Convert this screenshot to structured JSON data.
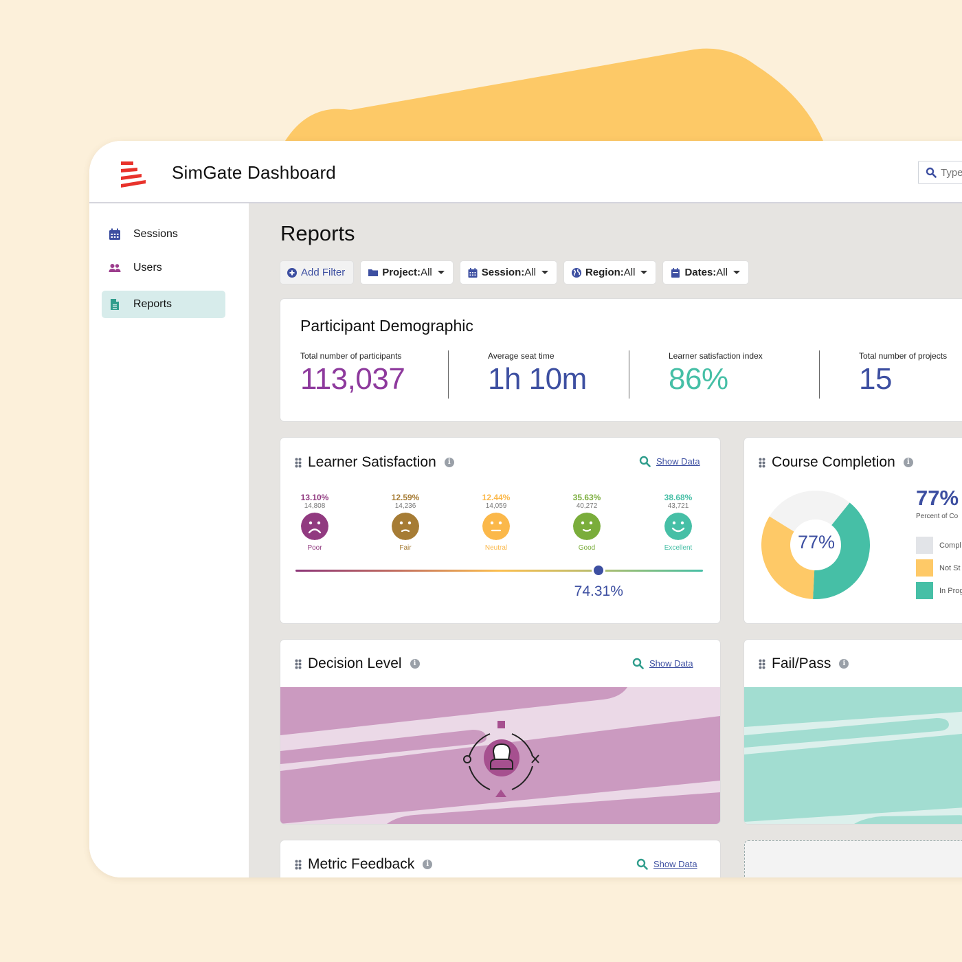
{
  "app": {
    "title": "SimGate Dashboard",
    "search_placeholder": "Type"
  },
  "sidebar": {
    "items": [
      {
        "label": "Sessions",
        "icon": "calendar-icon",
        "active": false
      },
      {
        "label": "Users",
        "icon": "users-icon",
        "active": false
      },
      {
        "label": "Reports",
        "icon": "document-icon",
        "active": true
      }
    ]
  },
  "page": {
    "title": "Reports",
    "filters": [
      {
        "label": "Add Filter",
        "key": "",
        "value": "",
        "icon": "plus-circle-icon"
      },
      {
        "key": "Project:",
        "value": " All",
        "icon": "folder-icon"
      },
      {
        "key": "Session:",
        "value": " All",
        "icon": "calendar-icon"
      },
      {
        "key": "Region:",
        "value": " All",
        "icon": "globe-icon"
      },
      {
        "key": "Dates:",
        "value": " All",
        "icon": "calendar-day-icon"
      }
    ]
  },
  "demographic": {
    "title": "Participant Demographic",
    "stats": [
      {
        "label": "Total number of participants",
        "value": "113,037",
        "color": "#8e3a9d"
      },
      {
        "label": "Average seat time",
        "value": "1h 10m",
        "color": "#3d4fa1"
      },
      {
        "label": "Learner satisfaction index",
        "value": "86%",
        "color": "#46bfa6"
      },
      {
        "label": "Total number of projects",
        "value": "15",
        "color": "#3d4fa1"
      }
    ]
  },
  "satisfaction": {
    "title": "Learner Satisfaction",
    "show_data": "Show Data",
    "levels": [
      {
        "name": "Poor",
        "pct": "13.10%",
        "count": "14,808",
        "color": "#913a80",
        "mood": "sad"
      },
      {
        "name": "Fair",
        "pct": "12.59%",
        "count": "14,236",
        "color": "#a67c35",
        "mood": "slight-sad"
      },
      {
        "name": "Neutral",
        "pct": "12.44%",
        "count": "14,059",
        "color": "#fbb84a",
        "mood": "neutral"
      },
      {
        "name": "Good",
        "pct": "35.63%",
        "count": "40,272",
        "color": "#7aad3b",
        "mood": "smile"
      },
      {
        "name": "Excellent",
        "pct": "38.68%",
        "count": "43,721",
        "color": "#46bfa6",
        "mood": "big-smile"
      }
    ],
    "index_value": 74.31,
    "index_label": "74.31%"
  },
  "completion": {
    "title": "Course Completion",
    "center_label": "77%",
    "headline": "77%",
    "headline_caption": "Percent of Co",
    "legend": [
      {
        "label": "Compl",
        "color": "#e2e4e8"
      },
      {
        "label": "Not St",
        "color": "#fec967"
      },
      {
        "label": "In Prog",
        "color": "#46bfa6"
      }
    ]
  },
  "decision": {
    "title": "Decision Level",
    "show_data": "Show Data"
  },
  "failpass": {
    "title": "Fail/Pass"
  },
  "metric": {
    "title": "Metric Feedback",
    "show_data": "Show Data"
  },
  "colors": {
    "accent": "#3d4fa1",
    "teal": "#46bfa6",
    "purple": "#8e3a9d",
    "logo_red": "#e8322b",
    "sand": "#fcf0da",
    "sun": "#fdc967"
  },
  "chart_data": [
    {
      "type": "pie",
      "title": "Course Completion",
      "categories": [
        "Completed",
        "Not Started",
        "In Progress"
      ],
      "values": [
        27,
        33,
        40
      ],
      "center_label": "77%"
    }
  ]
}
